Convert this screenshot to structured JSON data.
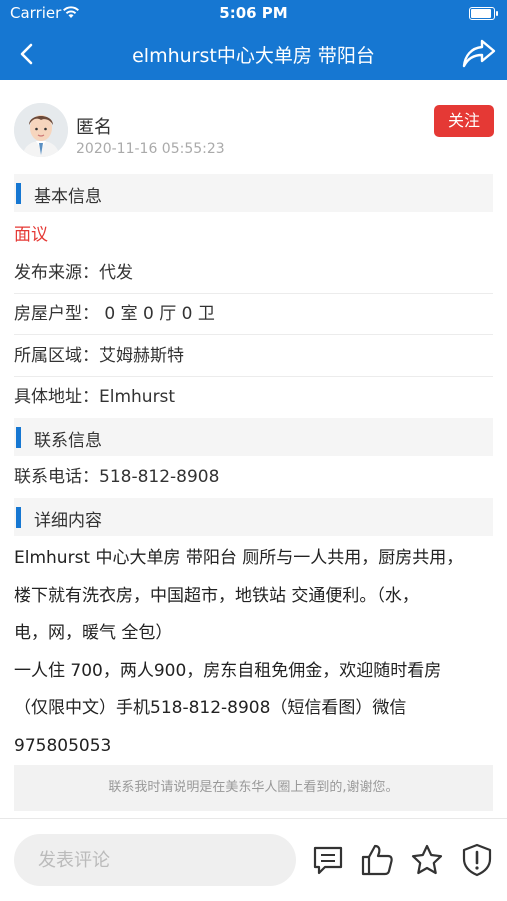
{
  "status_bar": {
    "carrier": "Carrier",
    "time": "5:06 PM",
    "battery_level": 1.0
  },
  "nav": {
    "title": "elmhurst中心大单房 带阳台",
    "back_icon": "back-arrow-icon",
    "share_icon": "share-icon"
  },
  "author": {
    "name": "匿名",
    "time": "2020-11-16 05:55:23",
    "follow_label": "关注",
    "avatar_icon": "user-avatar-icon"
  },
  "sections": {
    "basic": "基本信息",
    "contact": "联系信息",
    "detail": "详细内容"
  },
  "price": "面议",
  "basic_info": [
    {
      "text": "发布来源：代发"
    },
    {
      "text": "房屋户型： 0 室 0 厅 0 卫"
    },
    {
      "text": "所属区域：艾姆赫斯特"
    },
    {
      "text": "具体地址：Elmhurst"
    }
  ],
  "contact_info": {
    "phone": "联系电话：518-812-8908"
  },
  "detail_lines": [
    "Elmhurst 中心大单房 带阳台 厕所与一人共用，厨房共用，",
    "楼下就有洗衣房，中国超市，地铁站 交通便利。（水，",
    "电，网，暖气 全包）",
    "一人住 700，两人900，房东自租免佣金，欢迎随时看房",
    "（仅限中文）手机518-812-8908（短信看图）微信",
    "975805053"
  ],
  "notice": "联系我时请说明是在美东华人圈上看到的,谢谢您。",
  "bottom_bar": {
    "comment_placeholder": "发表评论",
    "icons": [
      "comment-icon",
      "thumbs-up-icon",
      "star-icon",
      "report-icon"
    ]
  },
  "colors": {
    "primary": "#1677d2",
    "accent_red": "#e53935"
  }
}
